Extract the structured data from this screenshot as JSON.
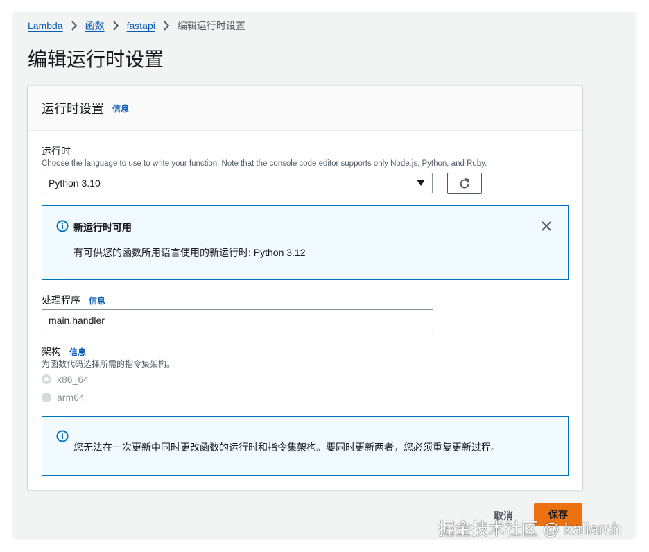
{
  "breadcrumb": {
    "items": [
      "Lambda",
      "函数",
      "fastapi"
    ],
    "current": "编辑运行时设置"
  },
  "page_title": "编辑运行时设置",
  "card": {
    "title": "运行时设置",
    "info": "信息"
  },
  "runtime": {
    "label": "运行时",
    "description": "Choose the language to use to write your function. Note that the console code editor supports only Node.js, Python, and Ruby.",
    "selected": "Python 3.10"
  },
  "alert_new_runtime": {
    "title": "新运行时可用",
    "text": "有可供您的函数所用语言使用的新运行时: Python 3.12"
  },
  "handler": {
    "label": "处理程序",
    "info": "信息",
    "value": "main.handler"
  },
  "architecture": {
    "label": "架构",
    "info": "信息",
    "description": "为函数代码选择所需的指令集架构。",
    "options": [
      "x86_64",
      "arm64"
    ],
    "selected": "x86_64"
  },
  "alert_arch": {
    "text": "您无法在一次更新中同时更改函数的运行时和指令集架构。要同时更新两者，您必须重复更新过程。"
  },
  "footer": {
    "cancel": "取消",
    "save": "保存"
  },
  "watermark": "掘金技术社区 @ kaliarch",
  "colors": {
    "link": "#0a5bb5",
    "primary": "#ec7211",
    "info_border": "#0073bb",
    "info_bg": "#f1faff"
  }
}
